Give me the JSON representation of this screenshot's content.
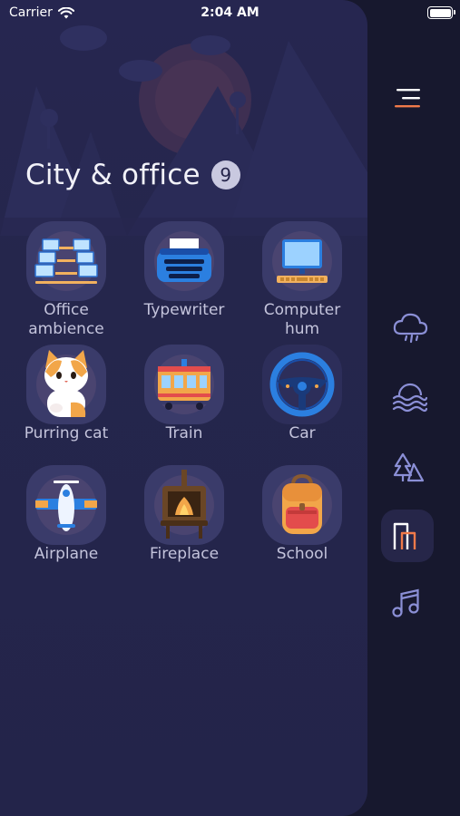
{
  "status_bar": {
    "carrier": "Carrier",
    "time": "2:04 AM"
  },
  "category": {
    "title": "City & office",
    "count": "9"
  },
  "sounds": [
    {
      "label": "Office\nambience",
      "icon": "office-ambience-icon"
    },
    {
      "label": "Typewriter",
      "icon": "typewriter-icon"
    },
    {
      "label": "Computer\nhum",
      "icon": "computer-icon"
    },
    {
      "label": "Purring cat",
      "icon": "cat-icon"
    },
    {
      "label": "Train",
      "icon": "train-icon"
    },
    {
      "label": "Car",
      "icon": "steering-wheel-icon"
    },
    {
      "label": "Airplane",
      "icon": "airplane-icon"
    },
    {
      "label": "Fireplace",
      "icon": "fireplace-icon"
    },
    {
      "label": "School",
      "icon": "backpack-icon"
    }
  ],
  "sidebar": {
    "items": [
      {
        "icon": "menu-icon"
      },
      {
        "icon": "rain-cloud-icon"
      },
      {
        "icon": "water-waves-icon"
      },
      {
        "icon": "forest-icon"
      },
      {
        "icon": "city-icon",
        "active": true
      },
      {
        "icon": "music-note-icon"
      }
    ]
  },
  "colors": {
    "accent": "#f07a4a",
    "sidebar_icon": "#8b8fd6",
    "tile": "#3a3b6a"
  }
}
